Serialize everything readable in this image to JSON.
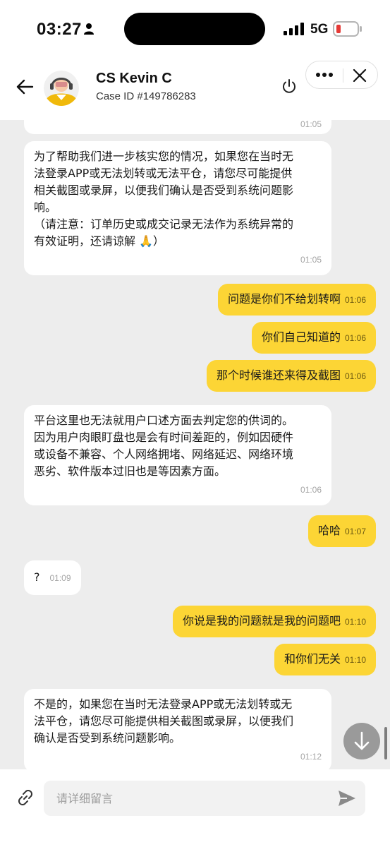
{
  "status_bar": {
    "time": "03:27",
    "network": "5G"
  },
  "header": {
    "agent_name": "CS Kevin C",
    "case_id": "Case ID #149786283"
  },
  "chat": {
    "prev_time": "01:05",
    "messages": [
      {
        "from": "agent",
        "text": "为了帮助我们进一步核实您的情况，如果您在当时无\n法登录APP或无法划转或无法平仓，请您尽可能提供\n相关截图或录屏，以便我们确认是否受到系统问题影\n响。\n（请注意：订单历史或成交记录无法作为系统异常的\n有效证明，还请谅解 🙏）",
        "time": "01:05"
      },
      {
        "from": "user",
        "text": "问题是你们不给划转啊",
        "time": "01:06"
      },
      {
        "from": "user",
        "text": "你们自己知道的",
        "time": "01:06"
      },
      {
        "from": "user",
        "text": "那个时候谁还来得及截图",
        "time": "01:06"
      },
      {
        "from": "agent",
        "text": "平台这里也无法就用户口述方面去判定您的供词的。\n因为用户肉眼盯盘也是会有时间差距的，例如因硬件\n或设备不兼容、个人网络拥堵、网络延迟、网络环境\n恶劣、软件版本过旧也是等因素方面。",
        "time": "01:06"
      },
      {
        "from": "user",
        "text": "哈哈",
        "time": "01:07"
      },
      {
        "from": "agent",
        "text": "?",
        "time": "01:09"
      },
      {
        "from": "user",
        "text": "你说是我的问题就是我的问题吧",
        "time": "01:10"
      },
      {
        "from": "user",
        "text": "和你们无关",
        "time": "01:10"
      },
      {
        "from": "agent",
        "text": "不是的，如果您在当时无法登录APP或无法划转或无\n法平仓，请您尽可能提供相关截图或录屏，以便我们\n确认是否受到系统问题影响。",
        "time": "01:12"
      }
    ]
  },
  "input": {
    "placeholder": "请详细留言",
    "value": ""
  },
  "colors": {
    "user_bubble": "#fcd535",
    "agent_bubble": "#ffffff",
    "chat_bg": "#ededed"
  },
  "icons": [
    "person-icon",
    "signal-icon",
    "battery-icon",
    "back-arrow-icon",
    "power-icon",
    "more-icon",
    "close-icon",
    "arrow-down-icon",
    "link-icon",
    "send-icon"
  ]
}
